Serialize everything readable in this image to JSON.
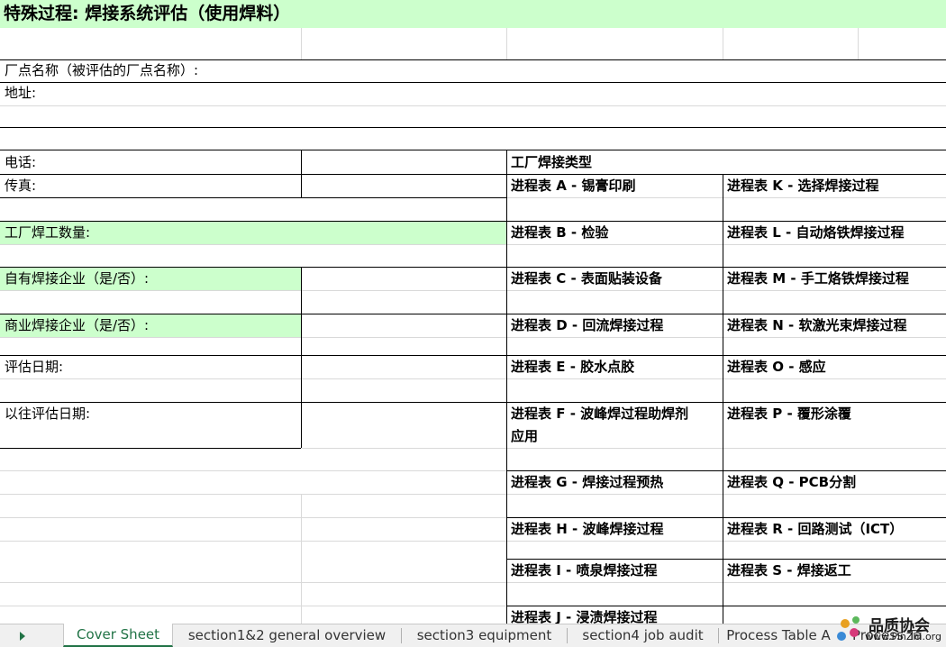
{
  "sheet": {
    "title": "特殊过程: 焊接系统评估（使用焊料）",
    "labels": {
      "plant_name": "厂点名称（被评估的厂点名称）:",
      "address": "地址:",
      "phone": "电话:",
      "fax": "传真:",
      "welder_count": "工厂焊工数量:",
      "own_welding": "自有焊接企业（是/否）:",
      "commercial_welding": "商业焊接企业（是/否）:",
      "assess_date": "评估日期:",
      "prev_assess_date": "以往评估日期:"
    },
    "welding_types_header": "工厂焊接类型",
    "left_types": [
      "进程表 A - 锡膏印刷",
      "进程表 B - 检验",
      "进程表 C - 表面贴装设备",
      "进程表 D - 回流焊接过程",
      "进程表 E - 胶水点胶",
      "进程表 F - 波峰焊过程助焊剂",
      "应用",
      "进程表 G - 焊接过程预热",
      "进程表 H - 波峰焊接过程",
      "进程表 I - 喷泉焊接过程",
      "进程表 J - 浸渍焊接过程"
    ],
    "right_types": [
      "进程表 K - 选择焊接过程",
      "进程表 L - 自动烙铁焊接过程",
      "进程表 M - 手工烙铁焊接过程",
      "进程表 N - 软激光束焊接过程",
      "进程表 O - 感应",
      "进程表 P - 覆形涂覆",
      "进程表 Q - PCB分割",
      "进程表 R - 回路测试（ICT）",
      "进程表 S - 焊接返工"
    ]
  },
  "tabs": [
    "Cover Sheet",
    "section1&2 general overview",
    "section3 equipment",
    "section4 job audit",
    "Process Table A",
    "Process Ta"
  ],
  "active_tab": "Cover Sheet",
  "watermark": {
    "name": "品质协会",
    "url": "www.PinZhi.org"
  },
  "colors": {
    "highlight_green": "#ccffcc",
    "active_tab": "#217346"
  }
}
